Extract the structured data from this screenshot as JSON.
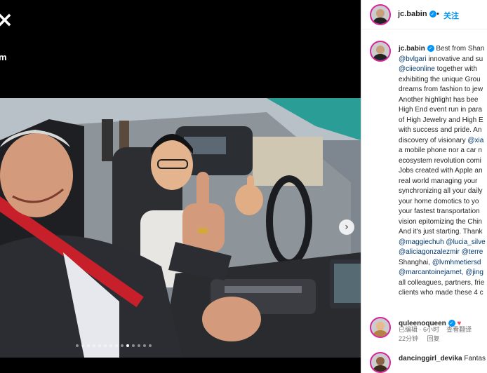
{
  "left_pane": {
    "close_icon": "close-icon",
    "side_text": "m"
  },
  "carousel": {
    "next_icon": "›",
    "dot_count": 14,
    "active_dot_index": 9
  },
  "post": {
    "username": "jc.babin",
    "separator": "•",
    "follow_label": "关注",
    "caption_lines": [
      {
        "text": "Best from Shan",
        "prefix_user": "jc.babin"
      },
      {
        "text": "@bvlgari innovative and su",
        "mention_prefix": "@bvlgari"
      },
      {
        "text": "@ciieonline together with",
        "mention_prefix": "@ciieonline"
      },
      {
        "text": "exhibiting the unique Grou"
      },
      {
        "text": "dreams from fashion to jew"
      },
      {
        "text": "Another highlight has bee"
      },
      {
        "text": "High End event run in para"
      },
      {
        "text": "of High Jewelry and High E"
      },
      {
        "text": "with success and pride. An"
      },
      {
        "text": "discovery of visionary @xia",
        "mention_suffix": "@xia"
      },
      {
        "text": "a mobile phone nor a car n"
      },
      {
        "text": "ecosystem revolution comi"
      },
      {
        "text": "Jobs created with Apple an"
      },
      {
        "text": "real world managing your"
      },
      {
        "text": "synchronizing all your daily"
      },
      {
        "text": "your home domotics to yo"
      },
      {
        "text": "your fastest transportation"
      },
      {
        "text": "vision epitomizing the Chin"
      },
      {
        "text": "And it's just starting. Thank"
      },
      {
        "text": "@maggiechuh @lucia_silve",
        "all_mention": true
      },
      {
        "text": "@aliciagonzalezmir @terre",
        "all_mention": true
      },
      {
        "text": "Shanghai, @lvmhmetiersd",
        "mention_suffix": "@lvmhmetiersd"
      },
      {
        "text": "@marcantoinejamet, @jing",
        "all_mention": true
      },
      {
        "text": "all colleagues, partners, frie"
      },
      {
        "text": "clients who made these 4 c"
      }
    ],
    "edited_label": "已编辑",
    "separator2": "·",
    "time_ago": "6小时",
    "translate_label": "查看翻译"
  },
  "comments": [
    {
      "username": "quleenoqueen",
      "text": "",
      "has_heart": true,
      "time": "22分钟",
      "reply_label": "回复"
    },
    {
      "username": "dancinggirl_devika",
      "text": "Fantas",
      "has_heart": false,
      "time": "",
      "reply_label": ""
    }
  ],
  "colors": {
    "accent": "#0095f6",
    "mention": "#00376b",
    "heart": "#ed4956"
  }
}
